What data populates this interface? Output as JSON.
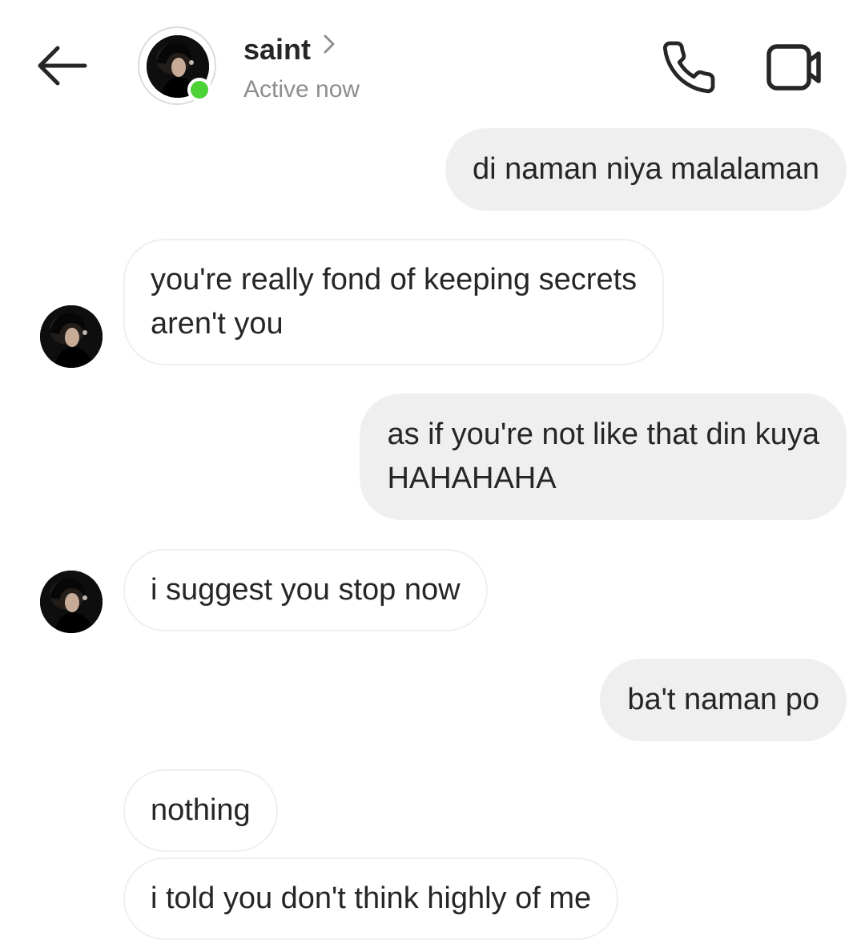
{
  "header": {
    "back_icon": "arrow-left-icon",
    "contact_name": "saint",
    "contact_status": "Active now",
    "online_color": "#4cd137",
    "call_icon": "phone-icon",
    "video_icon": "video-camera-icon"
  },
  "messages": [
    {
      "direction": "outgoing",
      "text": "di naman niya malalaman"
    },
    {
      "direction": "incoming",
      "text": "you're really fond of keeping secrets\naren't you"
    },
    {
      "direction": "outgoing",
      "text": "as if you're not like that din kuya\nHAHAHAHA"
    },
    {
      "direction": "incoming",
      "text": "i suggest you stop now"
    },
    {
      "direction": "outgoing",
      "text": "ba't naman po"
    },
    {
      "direction": "incoming",
      "text": "nothing"
    },
    {
      "direction": "incoming",
      "text": "i told you don't think highly of me"
    }
  ],
  "colors": {
    "outgoing_bubble": "#efefef",
    "incoming_border": "#efefef",
    "text": "#262626",
    "secondary_text": "#8e8e8e"
  }
}
